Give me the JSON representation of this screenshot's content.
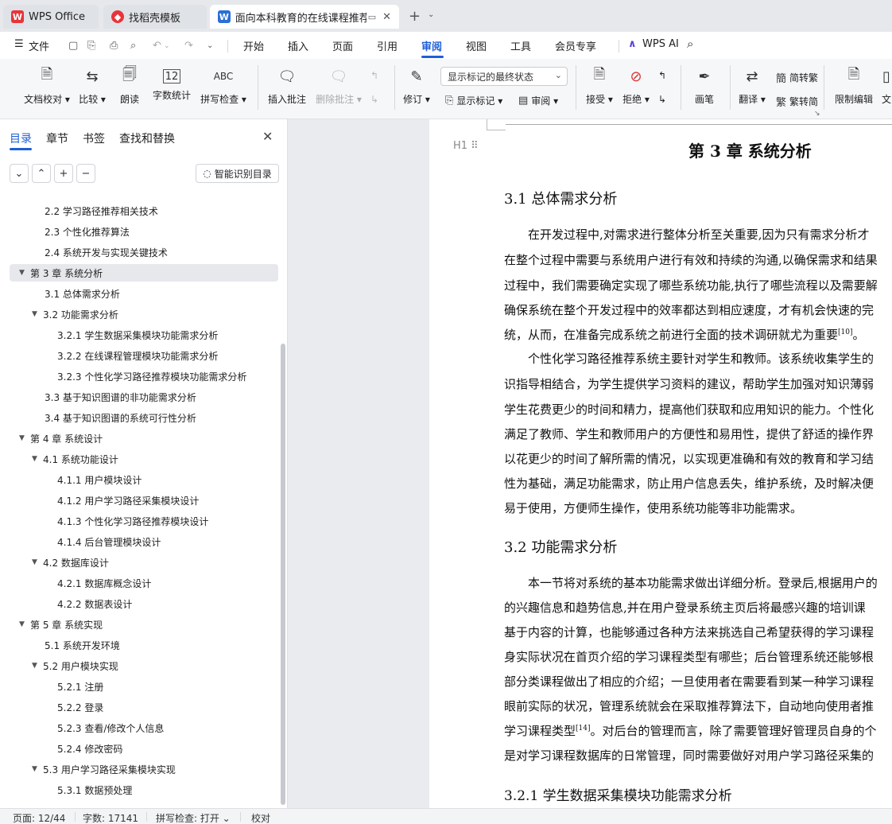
{
  "tabs": [
    {
      "label": "WPS Office",
      "icon": "wps-logo-icon"
    },
    {
      "label": "找稻壳模板",
      "icon": "daoke-logo-icon"
    },
    {
      "label": "面向本科教育的在线课程推荐",
      "icon": "word-doc-icon"
    }
  ],
  "menu": {
    "file": "文件",
    "items": [
      "开始",
      "插入",
      "页面",
      "引用",
      "审阅",
      "视图",
      "工具",
      "会员专享"
    ],
    "active": "审阅",
    "wps_ai": "WPS AI"
  },
  "ribbon": {
    "doc_check": "文档校对",
    "compare": "比较",
    "read_aloud": "朗读",
    "word_count": "字数统计",
    "spell_check": "拼写检查",
    "spell_icon_text": "ABC",
    "count_icon_text": "12",
    "insert_comment": "插入批注",
    "delete_comment": "删除批注",
    "revise": "修订",
    "markup_select": "显示标记的最终状态",
    "show_markup": "显示标记",
    "review": "审阅",
    "accept": "接受",
    "reject": "拒绝",
    "pen": "画笔",
    "translate": "翻译",
    "to_traditional": "简转繁",
    "to_simplified": "繁转简",
    "restrict_edit": "限制编辑",
    "text_cut": "文"
  },
  "nav": {
    "tabs": [
      "目录",
      "章节",
      "书签",
      "查找和替换"
    ],
    "smart_toc": "智能识别目录",
    "items": [
      {
        "level": 2,
        "text": "2.2  学习路径推荐相关技术",
        "expandable": false,
        "selected": false
      },
      {
        "level": 2,
        "text": "2.3  个性化推荐算法",
        "expandable": false,
        "selected": false
      },
      {
        "level": 2,
        "text": "2.4  系统开发与实现关键技术",
        "expandable": false,
        "selected": false
      },
      {
        "level": 1,
        "text": "第 3 章  系统分析",
        "expandable": true,
        "selected": true
      },
      {
        "level": 2,
        "text": "3.1  总体需求分析",
        "expandable": false,
        "selected": false
      },
      {
        "level": 2,
        "text": "3.2  功能需求分析",
        "expandable": true,
        "selected": false
      },
      {
        "level": 3,
        "text": "3.2.1 学生数据采集模块功能需求分析",
        "expandable": false,
        "selected": false
      },
      {
        "level": 3,
        "text": "3.2.2 在线课程管理模块功能需求分析",
        "expandable": false,
        "selected": false
      },
      {
        "level": 3,
        "text": "3.2.3 个性化学习路径推荐模块功能需求分析",
        "expandable": false,
        "selected": false
      },
      {
        "level": 2,
        "text": "3.3  基于知识图谱的非功能需求分析",
        "expandable": false,
        "selected": false
      },
      {
        "level": 2,
        "text": "3.4  基于知识图谱的系统可行性分析",
        "expandable": false,
        "selected": false
      },
      {
        "level": 1,
        "text": "第 4 章  系统设计",
        "expandable": true,
        "selected": false
      },
      {
        "level": 2,
        "text": "4.1  系统功能设计",
        "expandable": true,
        "selected": false
      },
      {
        "level": 3,
        "text": "4.1.1  用户模块设计",
        "expandable": false,
        "selected": false
      },
      {
        "level": 3,
        "text": "4.1.2  用户学习路径采集模块设计",
        "expandable": false,
        "selected": false
      },
      {
        "level": 3,
        "text": "4.1.3  个性化学习路径推荐模块设计",
        "expandable": false,
        "selected": false
      },
      {
        "level": 3,
        "text": "4.1.4  后台管理模块设计",
        "expandable": false,
        "selected": false
      },
      {
        "level": 2,
        "text": "4.2  数据库设计",
        "expandable": true,
        "selected": false
      },
      {
        "level": 3,
        "text": "4.2.1  数据库概念设计",
        "expandable": false,
        "selected": false
      },
      {
        "level": 3,
        "text": "4.2.2  数据表设计",
        "expandable": false,
        "selected": false
      },
      {
        "level": 1,
        "text": "第 5 章  系统实现",
        "expandable": true,
        "selected": false
      },
      {
        "level": 2,
        "text": "5.1  系统开发环境",
        "expandable": false,
        "selected": false
      },
      {
        "level": 2,
        "text": "5.2  用户模块实现",
        "expandable": true,
        "selected": false
      },
      {
        "level": 3,
        "text": "5.2.1  注册",
        "expandable": false,
        "selected": false
      },
      {
        "level": 3,
        "text": "5.2.2  登录",
        "expandable": false,
        "selected": false
      },
      {
        "level": 3,
        "text": "5.2.3  查看/修改个人信息",
        "expandable": false,
        "selected": false
      },
      {
        "level": 3,
        "text": "5.2.4  修改密码",
        "expandable": false,
        "selected": false
      },
      {
        "level": 2,
        "text": "5.3  用户学习路径采集模块实现",
        "expandable": true,
        "selected": false
      },
      {
        "level": 3,
        "text": "5.3.1  数据预处理",
        "expandable": false,
        "selected": false
      }
    ]
  },
  "doc": {
    "chapter_title": "第 3 章  系统分析",
    "heading_marker": "H1",
    "sec31_title": "3.1  总体需求分析",
    "para1": [
      "在开发过程中,对需求进行整体分析至关重要,因为只有需求分析才",
      "在整个过程中需要与系统用户进行有效和持续的沟通,以确保需求和结果",
      "过程中，我们需要确定实现了哪些系统功能,执行了哪些流程以及需要解",
      "确保系统在整个开发过程中的效率都达到相应速度，才有机会快速的完",
      "统，从而，在准备完成系统之前进行全面的技术调研就尤为重要"
    ],
    "para1_cite": "[10]",
    "para1_end": "。",
    "para2": [
      "个性化学习路径推荐系统主要针对学生和教师。该系统收集学生的",
      "识指导相结合，为学生提供学习资料的建议，帮助学生加强对知识薄弱",
      "学生花费更少的时间和精力，提高他们获取和应用知识的能力。个性化",
      "满足了教师、学生和教师用户的方便性和易用性，提供了舒适的操作界",
      "以花更少的时间了解所需的情况，以实现更准确和有效的教育和学习结",
      "性为基础，满足功能需求，防止用户信息丢失，维护系统，及时解决便",
      "易于使用，方便师生操作，使用系统功能等非功能需求。"
    ],
    "sec32_title": "3.2  功能需求分析",
    "para3": [
      "本一节将对系统的基本功能需求做出详细分析。登录后,根据用户的",
      "的兴趣信息和趋势信息,并在用户登录系统主页后将最感兴趣的培训课",
      "基于内容的计算，也能够通过各种方法来挑选自己希望获得的学习课程",
      "身实际状况在首页介绍的学习课程类型有哪些；后台管理系统还能够根",
      "部分类课程做出了相应的介绍；一旦使用者在需要看到某一种学习课程",
      "眼前实际的状况，管理系统就会在采取推荐算法下，自动地向使用者推",
      "学习课程类型"
    ],
    "para3_cite": "[14]",
    "para3_tail": "。对后台的管理而言，除了需要管理好管理员自身的个",
    "para3_last": "是对学习课程数据库的日常管理，同时需要做好对用户学习路径采集的",
    "sec321_title": "3.2.1 学生数据采集模块功能需求分析"
  },
  "status": {
    "page": "页面: 12/44",
    "words": "字数: 17141",
    "spell": "拼写检查: 打开",
    "proof": "校对"
  },
  "colors": {
    "accent": "#1f5fd6",
    "wps_red": "#e8343a",
    "doc_blue": "#2a6fd6"
  }
}
